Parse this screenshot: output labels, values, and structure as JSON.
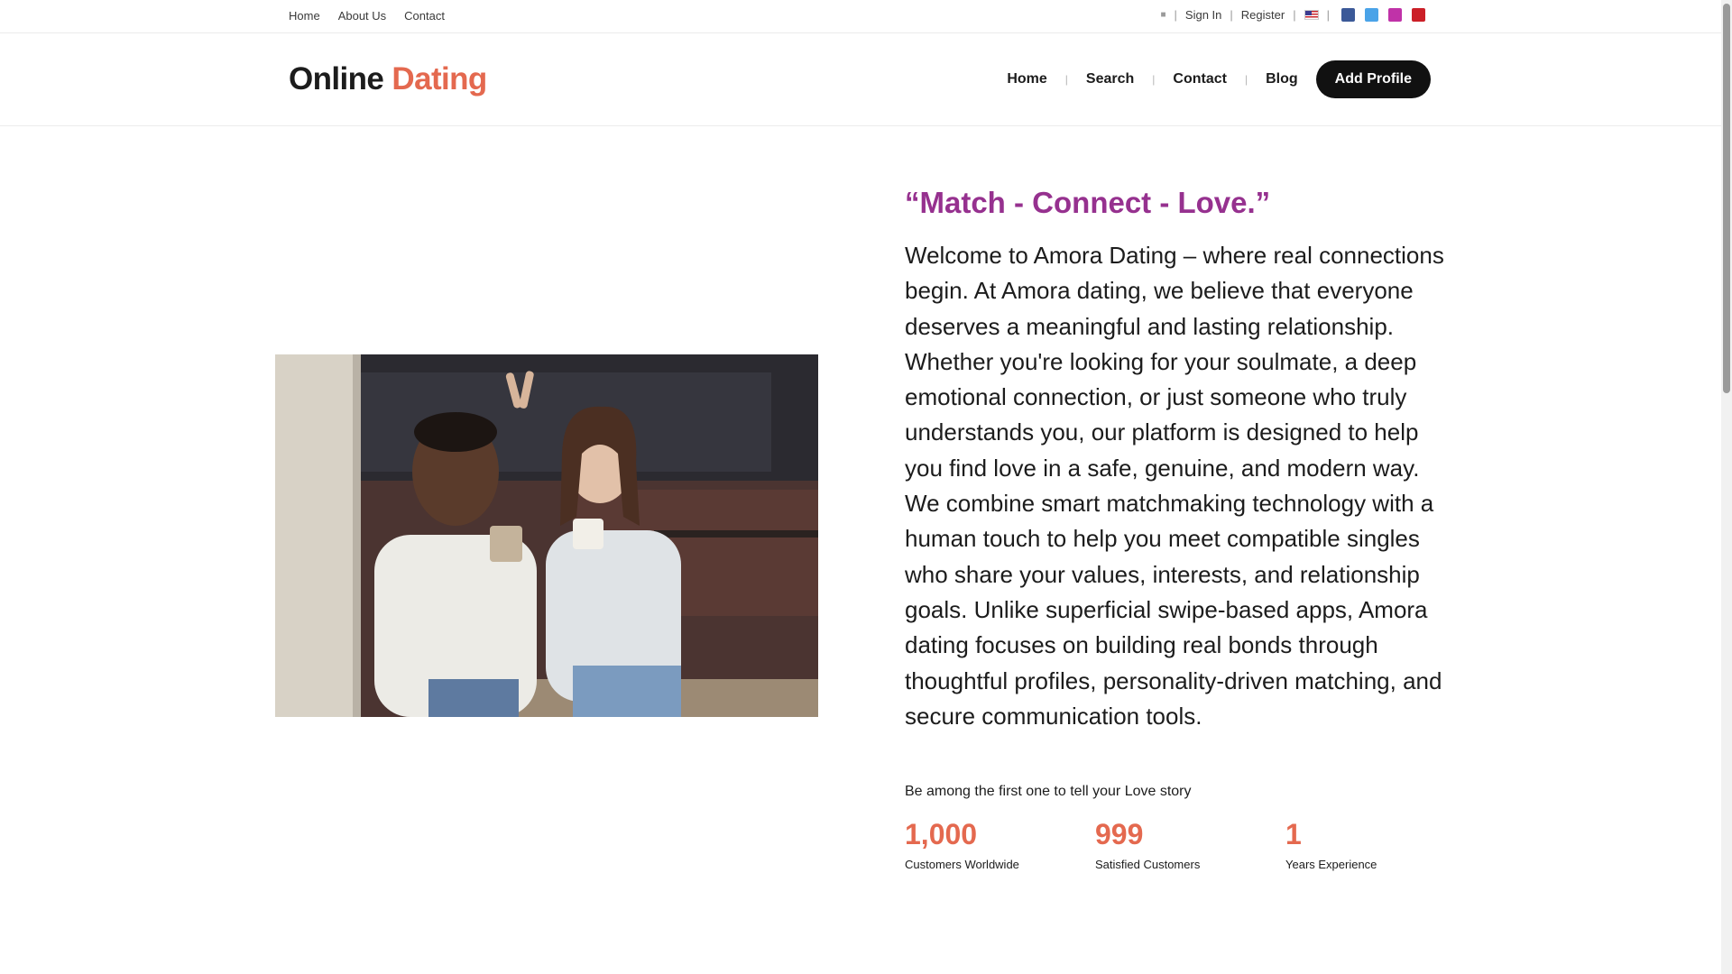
{
  "topbar": {
    "nav": [
      "Home",
      "About Us",
      "Contact"
    ],
    "user_icon": "user-icon",
    "sign_in": "Sign In",
    "register": "Register",
    "separator": "|",
    "language_flag": "us-flag-icon",
    "social": [
      {
        "name": "facebook-icon",
        "color": "#3b5998"
      },
      {
        "name": "twitter-icon",
        "color": "#4aa3e8"
      },
      {
        "name": "instagram-icon",
        "color": "#c032a8"
      },
      {
        "name": "pinterest-icon",
        "color": "#cb1f27"
      }
    ]
  },
  "header": {
    "logo_main": "Online",
    "logo_accent": "Dating",
    "nav": [
      "Home",
      "Search",
      "Contact",
      "Blog"
    ],
    "cta_button": "Add Profile"
  },
  "hero": {
    "tagline": "“Match - Connect - Love.”",
    "intro": "Welcome to Amora Dating – where real connections begin. At Amora dating, we believe that everyone deserves a meaningful and lasting relationship. Whether you're looking for your soulmate, a deep emotional connection, or just someone who truly understands you, our platform is designed to help you find love in a safe, genuine, and modern way. We combine smart matchmaking technology with a human touch to help you meet compatible singles who share your values, interests, and relationship goals. Unlike superficial swipe-based apps, Amora dating focuses on building real bonds through thoughtful profiles, personality-driven matching, and secure communication tools.",
    "cta_text": "Be among the first one to tell your Love story",
    "image": "couple-with-coffee-mugs-photo"
  },
  "stats": [
    {
      "value": "1,000",
      "label": "Customers Worldwide"
    },
    {
      "value": "999",
      "label": "Satisfied Customers"
    },
    {
      "value": "1",
      "label": "Years Experience"
    }
  ],
  "colors": {
    "accent": "#e4694f",
    "tagline": "#96318f",
    "button": "#111111"
  }
}
